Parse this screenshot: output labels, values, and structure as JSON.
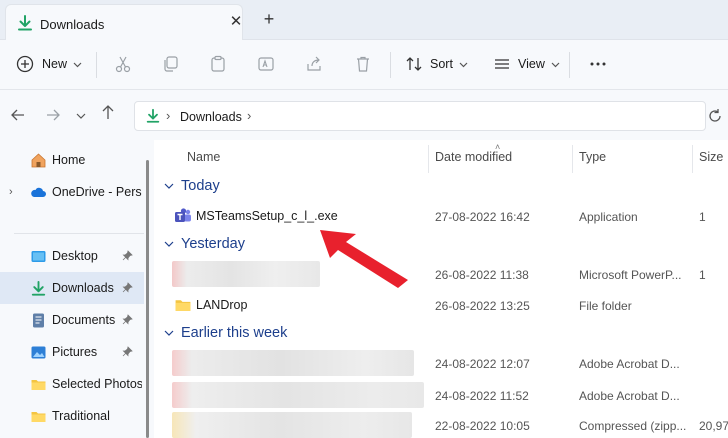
{
  "window": {
    "tab_title": "Downloads",
    "tab_icon": "download-icon",
    "close_icon": "close-icon",
    "new_tab_icon": "plus-icon"
  },
  "toolbar": {
    "new_label": "New",
    "sort_label": "Sort",
    "view_label": "View",
    "icons": [
      "add-icon",
      "cut-icon",
      "copy-icon",
      "paste-icon",
      "rename-icon",
      "share-icon",
      "delete-icon",
      "sort-icon",
      "view-icon",
      "more-icon"
    ]
  },
  "address": {
    "path": "Downloads"
  },
  "sidebar": {
    "items": [
      {
        "label": "Home",
        "icon": "home-icon"
      },
      {
        "label": "OneDrive - Personal",
        "icon": "cloud-icon"
      },
      {
        "label": "Desktop",
        "icon": "desktop-icon",
        "pinned": true
      },
      {
        "label": "Downloads",
        "icon": "download-icon",
        "pinned": true,
        "active": true
      },
      {
        "label": "Documents",
        "icon": "documents-icon",
        "pinned": true
      },
      {
        "label": "Pictures",
        "icon": "pictures-icon",
        "pinned": true
      },
      {
        "label": "Selected Photos",
        "icon": "folder-icon"
      },
      {
        "label": "Traditional",
        "icon": "folder-icon"
      }
    ]
  },
  "columns": {
    "name": "Name",
    "date": "Date modified",
    "type": "Type",
    "size": "Size"
  },
  "groups": {
    "today": "Today",
    "yesterday": "Yesterday",
    "earlier": "Earlier this week"
  },
  "files": [
    {
      "name": "MSTeamsSetup_c_l_.exe",
      "date": "27-08-2022 16:42",
      "type": "Application",
      "size": "1"
    },
    {
      "name": "",
      "date": "26-08-2022 11:38",
      "type": "Microsoft PowerP...",
      "size": "1"
    },
    {
      "name": "LANDrop",
      "date": "26-08-2022 13:25",
      "type": "File folder",
      "size": ""
    },
    {
      "name": "",
      "date": "24-08-2022 12:07",
      "type": "Adobe Acrobat D...",
      "size": ""
    },
    {
      "name": "",
      "date": "24-08-2022 11:52",
      "type": "Adobe Acrobat D...",
      "size": ""
    },
    {
      "name": "",
      "date": "22-08-2022 10:05",
      "type": "Compressed (zipp...",
      "size": "20,97"
    }
  ],
  "colors": {
    "accent": "#1d3f8c",
    "download_green": "#21a366",
    "folder": "#f4c542",
    "arrow": "#e8212d"
  }
}
